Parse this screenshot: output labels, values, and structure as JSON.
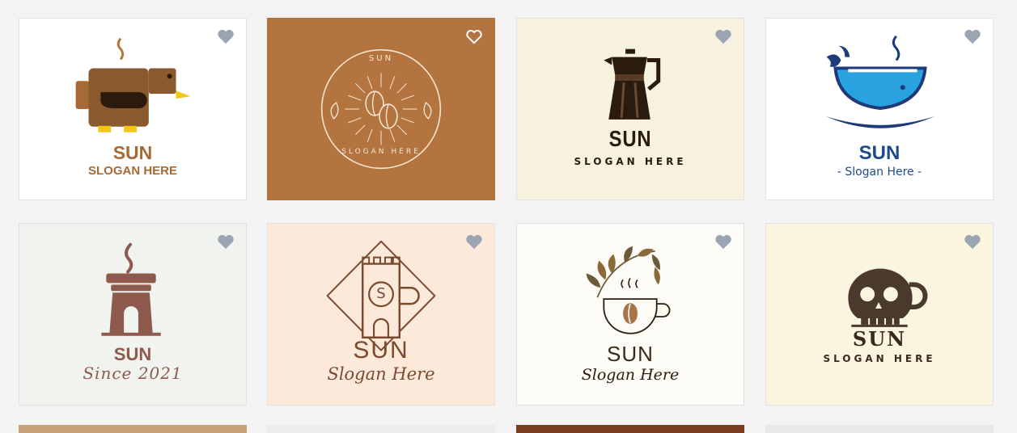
{
  "colors": {
    "page_bg": "#f3f3f3",
    "heart_gray": "#9aa4b2",
    "heart_white": "#ffffff"
  },
  "cards": [
    {
      "brand": "SUN",
      "slogan": "SLOGAN HERE",
      "bg": "#ffffff",
      "favorite_icon": "heart-icon"
    },
    {
      "brand": "SUN",
      "slogan": "SLOGAN HERE",
      "bg": "#b37440",
      "favorite_icon": "heart-outline-icon"
    },
    {
      "brand": "SUN",
      "slogan": "SLOGAN HERE",
      "bg": "#f7f1e0",
      "favorite_icon": "heart-icon"
    },
    {
      "brand": "SUN",
      "slogan": "- Slogan Here -",
      "bg": "#ffffff",
      "favorite_icon": "heart-icon"
    },
    {
      "brand": "SUN",
      "slogan": "Since 2021",
      "bg": "#f1f3ee",
      "favorite_icon": "heart-icon"
    },
    {
      "brand": "SUN",
      "slogan": "Slogan Here",
      "bg": "#fde9da",
      "favorite_icon": "heart-icon"
    },
    {
      "brand": "SUN",
      "slogan": "Slogan Here",
      "bg": "#fdfbf5",
      "favorite_icon": "heart-icon"
    },
    {
      "brand": "SUN",
      "slogan": "SLOGAN HERE",
      "bg": "#fbf4df",
      "favorite_icon": "heart-icon"
    }
  ]
}
